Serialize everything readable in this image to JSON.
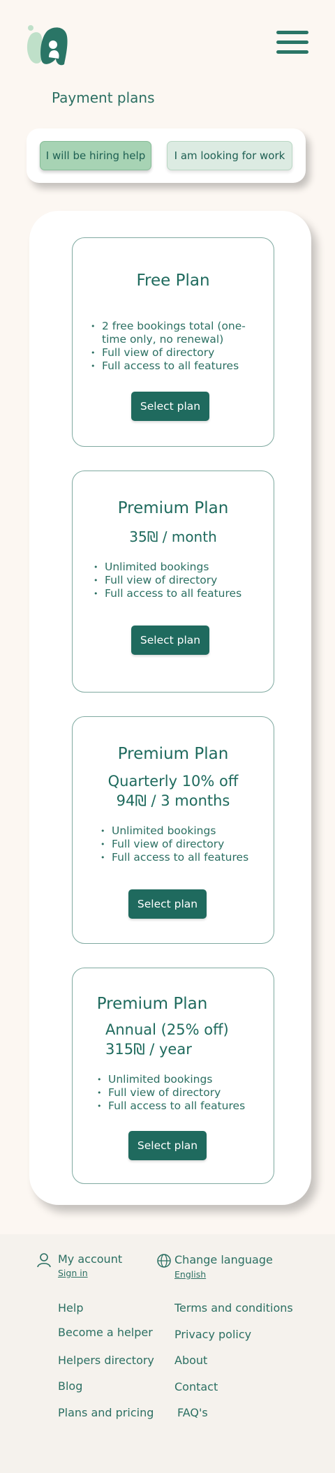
{
  "header": {
    "logo_icon": "brand-logo-icon",
    "menu_icon": "hamburger-menu-icon"
  },
  "page_title": "Payment plans",
  "toggle": {
    "hiring_label": "I will be hiring help",
    "working_label": "I am looking for work",
    "active": "hiring"
  },
  "plans": [
    {
      "name": "Free Plan",
      "features": [
        "2 free bookings total (one-time only, no renewal)",
        "Full view of directory",
        "Full access to all features"
      ],
      "button": "Select plan"
    },
    {
      "name": "Premium Plan",
      "price": "35₪ / month",
      "features": [
        "Unlimited bookings",
        "Full view of directory",
        "Full access to all features"
      ],
      "button": "Select plan"
    },
    {
      "name": "Premium Plan",
      "price_line1": "Quarterly 10% off",
      "price_line2": "94₪ / 3 months",
      "features": [
        "Unlimited bookings",
        "Full view of directory",
        "Full access to all features"
      ],
      "button": "Select plan"
    },
    {
      "name": "Premium Plan",
      "price_line1": "Annual (25% off)",
      "price_line2": "315₪ / year",
      "features": [
        "Unlimited bookings",
        "Full view of directory",
        "Full access to all features"
      ],
      "button": "Select plan"
    }
  ],
  "footer": {
    "account_label": "My account",
    "account_sub": "Sign in",
    "language_label": "Change language",
    "language_sub": "English",
    "links_left": [
      "Help",
      "Become a helper",
      "Helpers directory",
      "Blog",
      "Plans and pricing"
    ],
    "links_right": [
      "Terms and conditions",
      "Privacy policy",
      "About",
      "Contact",
      "FAQ's"
    ]
  },
  "colors": {
    "page_bg": "#fcf7f2",
    "primary": "#1f6a5e",
    "active_toggle": "#a7d3b4",
    "inactive_toggle": "#dcebe2"
  }
}
